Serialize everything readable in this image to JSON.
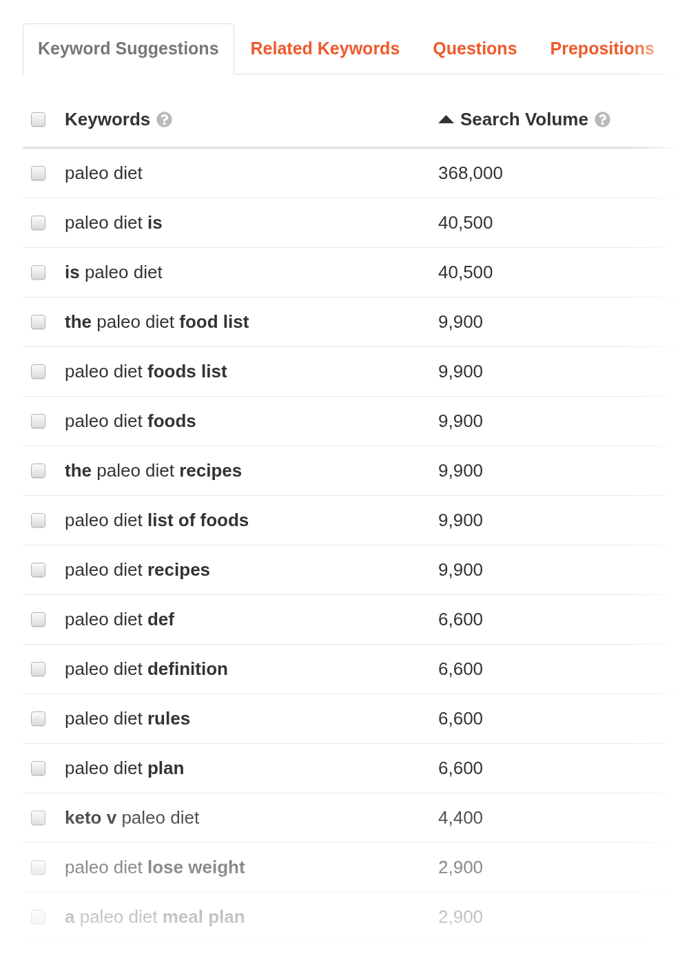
{
  "tabs": [
    {
      "label": "Keyword Suggestions",
      "selected": true
    },
    {
      "label": "Related Keywords",
      "selected": false
    },
    {
      "label": "Questions",
      "selected": false
    },
    {
      "label": "Prepositions",
      "selected": false
    }
  ],
  "table": {
    "select_all": {
      "checked": false
    },
    "columns": [
      {
        "label": "Keywords",
        "help": true,
        "sorted": false
      },
      {
        "label": "Search Volume",
        "help": true,
        "sorted": true
      }
    ],
    "rows": [
      {
        "checked": false,
        "keyword": "paleo diet",
        "volume": "368,000"
      },
      {
        "checked": false,
        "keyword": "paleo diet **is**",
        "volume": "40,500"
      },
      {
        "checked": false,
        "keyword": "**is** paleo diet",
        "volume": "40,500"
      },
      {
        "checked": false,
        "keyword": "**the** paleo diet **food list**",
        "volume": "9,900"
      },
      {
        "checked": false,
        "keyword": "paleo diet **foods list**",
        "volume": "9,900"
      },
      {
        "checked": false,
        "keyword": "paleo diet **foods**",
        "volume": "9,900"
      },
      {
        "checked": false,
        "keyword": "**the** paleo diet **recipes**",
        "volume": "9,900"
      },
      {
        "checked": false,
        "keyword": "paleo diet **list of foods**",
        "volume": "9,900"
      },
      {
        "checked": false,
        "keyword": "paleo diet **recipes**",
        "volume": "9,900"
      },
      {
        "checked": false,
        "keyword": "paleo diet **def**",
        "volume": "6,600"
      },
      {
        "checked": false,
        "keyword": "paleo diet **definition**",
        "volume": "6,600"
      },
      {
        "checked": false,
        "keyword": "paleo diet **rules**",
        "volume": "6,600"
      },
      {
        "checked": false,
        "keyword": "paleo diet **plan**",
        "volume": "6,600"
      },
      {
        "checked": false,
        "keyword": "**keto v** paleo diet",
        "volume": "4,400"
      },
      {
        "checked": false,
        "keyword": "paleo diet **lose weight**",
        "volume": "2,900"
      },
      {
        "checked": false,
        "keyword": "**a** paleo diet **meal plan**",
        "volume": "2,900"
      }
    ]
  }
}
